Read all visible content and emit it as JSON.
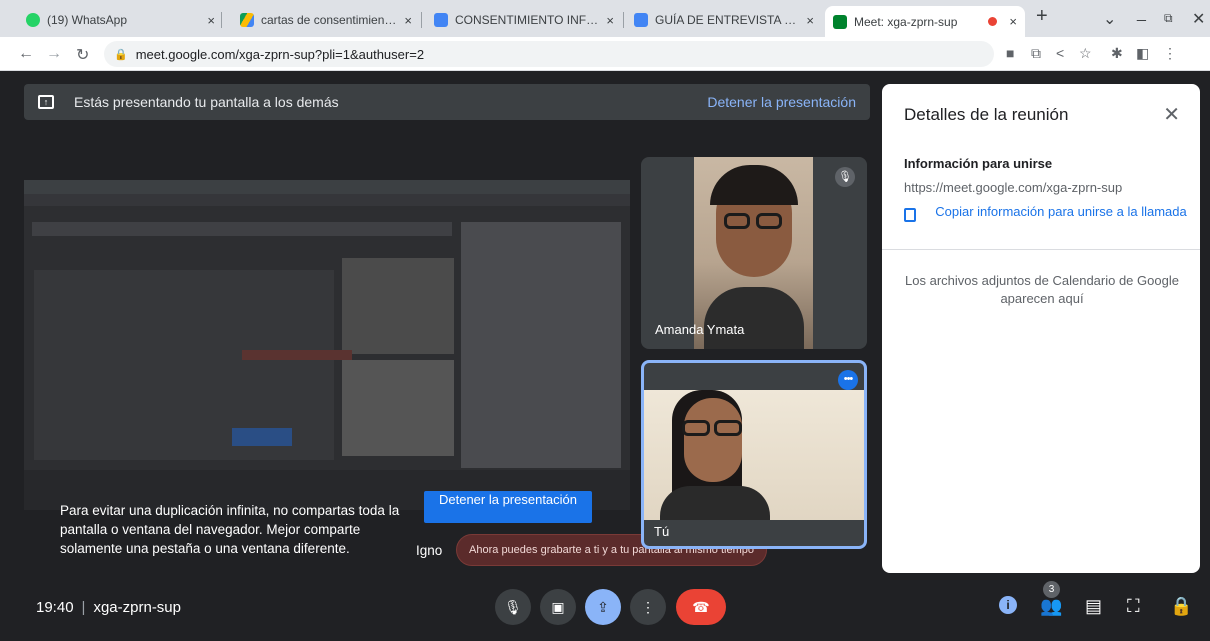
{
  "browser": {
    "tabs": [
      {
        "title": "(19) WhatsApp",
        "color": "#25d366"
      },
      {
        "title": "cartas de consentimiento - Go",
        "color": "#fbbc04"
      },
      {
        "title": "CONSENTIMIENTO INFORMAD",
        "color": "#4285f4"
      },
      {
        "title": "GUÍA DE ENTREVISTA Dra. Am",
        "color": "#4285f4"
      },
      {
        "title": "Meet: xga-zprn-sup",
        "color": "#00832d"
      }
    ],
    "close_glyph": "×",
    "new_tab": "+",
    "address": "meet.google.com/xga-zprn-sup?pli=1&authuser=2"
  },
  "banner": {
    "text": "Estás presentando tu pantalla a los demás",
    "stop": "Detener la presentación"
  },
  "shared": {
    "warning": "Para evitar una duplicación infinita, no compartas toda la pantalla o ventana del navegador. Mejor comparte solamente una pestaña o una ventana diferente.",
    "stop_button": "Detener la presentación",
    "ignore": "Igno",
    "toast": "Ahora puedes grabarte a ti y a tu pantalla al mismo tiempo"
  },
  "participants": [
    {
      "name": "Amanda Ymata"
    },
    {
      "name": "Tú"
    }
  ],
  "panel": {
    "title": "Detalles de la reunión",
    "join_heading": "Información para unirse",
    "link": "https://meet.google.com/xga-zprn-sup",
    "copy": "Copiar información para unirse a la llamada",
    "attachments": "Los archivos adjuntos de Calendario de Google aparecen aquí"
  },
  "bottom": {
    "time": "19:40",
    "code": "xga-zprn-sup",
    "people_count": "3"
  },
  "colors": {
    "accent": "#8ab4f8",
    "blue": "#1a73e8",
    "hangup": "#ea4335",
    "background": "#202124"
  }
}
